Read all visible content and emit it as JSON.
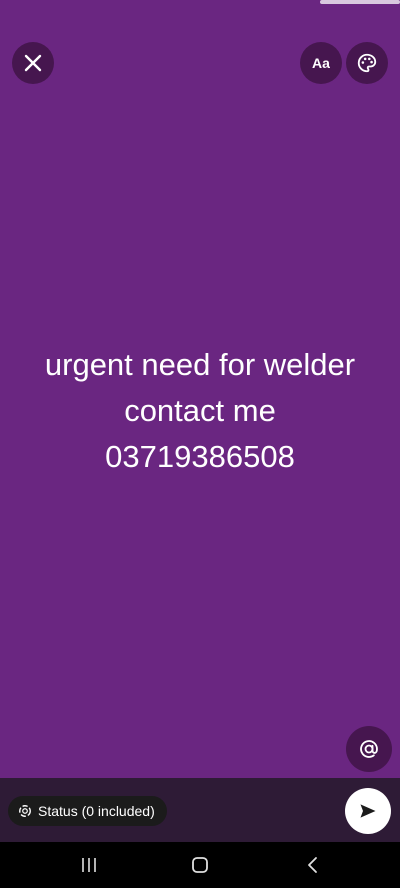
{
  "colors": {
    "background": "#6a2681",
    "button_bg": "#46164f",
    "bottom_bar": "#2e1b36",
    "pill_bg": "#1b1b1b",
    "send_bg": "#ffffff",
    "nav_bar": "#000000",
    "text": "#ffffff"
  },
  "toolbar": {
    "close_icon": "close-icon",
    "font_label": "Aa",
    "palette_icon": "palette-icon"
  },
  "status_text": {
    "lines": [
      "urgent need for welder",
      "contact me",
      "03719386508"
    ]
  },
  "mention_icon": "at-sign-icon",
  "bottom_bar": {
    "status_label": "Status (0 included)",
    "status_icon": "status-icon",
    "send_icon": "send-icon"
  },
  "nav": {
    "recent_icon": "recent-apps-icon",
    "home_icon": "home-icon",
    "back_icon": "back-icon"
  }
}
